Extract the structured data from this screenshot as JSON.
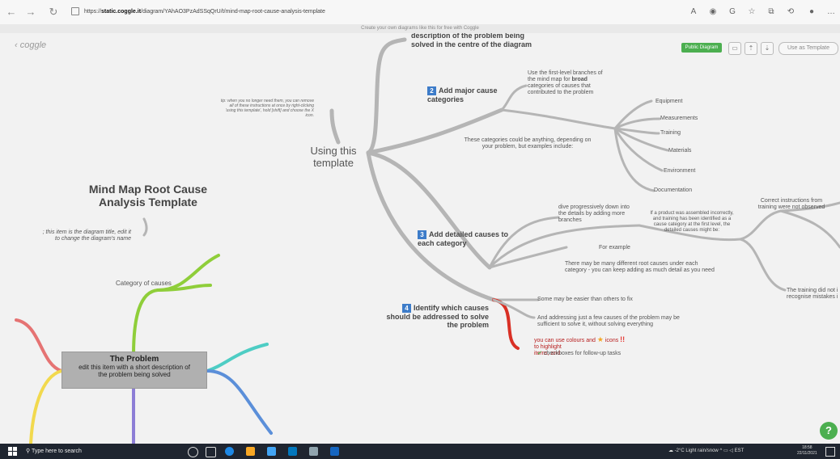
{
  "browser": {
    "url_prefix": "https://",
    "url_domain": "static.coggle.it",
    "url_path": "/diagram/YAhAO3PzAdSSqQrU/t/mind-map-root-cause-analysis-template",
    "banner": "Create your own diagrams like this for free with Coggle"
  },
  "app": {
    "logo": "‹ coggle",
    "public_label": "Public Diagram",
    "use_template_label": "Use as Template"
  },
  "map": {
    "top_partial": "description of the problem being\nsolved in the centre of the diagram",
    "tip": "tip: when you no longer need them, you can remove\nall of these instructions at once by right-clicking\n'using this template', hold [shift] and choose the X\nicon.",
    "center": "Using this\ntemplate",
    "title": "Mind Map Root Cause\nAnalysis Template",
    "title_note": "; this item is the diagram title, edit it\nto change the diagram's name",
    "step2_num": "2",
    "step2": "Add major cause\ncategories",
    "step2_desc_a": "Use the first-level branches of\nthe mind map for ",
    "step2_desc_bold": "broad",
    "step2_desc_b": "\ncategories of causes that\ncontributed to the problem",
    "categories_desc": "These categories could be anything, depending on\nyour problem, but examples include:",
    "categories": [
      "Equipment",
      "Measurements",
      "Training",
      "Materials",
      "Environment",
      "Documentation"
    ],
    "step3_num": "3",
    "step3": "Add detailed causes to\neach category",
    "dive": "dive progressively down into\nthe details by adding more\nbranches",
    "example_desc": "If a product was assembled incorrectly,\nand training has been identified as a\ncause category at the first level, the\ndetailed causes might be:",
    "for_example": "For example",
    "correct_instr": "Correct instructions from\ntraining were not observed",
    "training_not": "The training did not i\nrecognise mistakes i",
    "many_causes": "There may be many different root causes under each\ncategory - you can keep adding as much detail as you need",
    "step4_num": "4",
    "step4": "Identify which causes\nshould be addressed to solve\nthe problem",
    "easier": "Some may be easier than others to fix",
    "addressing": "And addressing just a few causes of the problem may be\nsufficient to solve it, without solving everything",
    "colours_a": "you can use colours and",
    "colours_b": "icons",
    "colours_c": "to highlight\nitems, and",
    "checkboxes": "checkboxes for follow-up tasks",
    "category_of_causes": "Category of causes",
    "problem_title": "The Problem",
    "problem_sub": "edit this item with a short description of\nthe problem being solved",
    "help": "?"
  },
  "taskbar": {
    "search_placeholder": "Type here to search",
    "weather": "-2°C  Light rain/snow",
    "lang": "EST",
    "time": "18:58",
    "date": "22/11/2021"
  }
}
